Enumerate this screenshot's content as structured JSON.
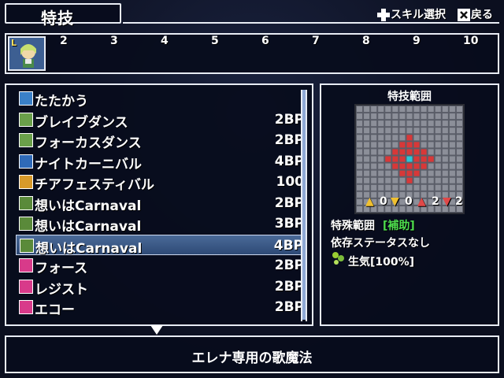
{
  "header": {
    "title": "特技",
    "skill_select": "スキル選択",
    "back": "戻る"
  },
  "party": {
    "portrait_badge": "L",
    "slots": [
      "2",
      "3",
      "4",
      "5",
      "6",
      "7",
      "8",
      "9",
      "10"
    ]
  },
  "skills": [
    {
      "name": "たたかう",
      "cost": "",
      "icon": "sword-icon",
      "icon_color": "#3a80c8"
    },
    {
      "name": "ブレイブダンス",
      "cost": "2BP",
      "icon": "plus-icon",
      "icon_color": "#6aa04a"
    },
    {
      "name": "フォーカスダンス",
      "cost": "2BP",
      "icon": "plus-icon",
      "icon_color": "#6aa04a"
    },
    {
      "name": "ナイトカーニバル",
      "cost": "4BP",
      "icon": "square-icon",
      "icon_color": "#2f6ab8"
    },
    {
      "name": "チアフェスティバル",
      "cost": "100",
      "icon": "star-burst-icon",
      "icon_color": "#d89a2a"
    },
    {
      "name": "想いはCarnaval",
      "cost": "2BP",
      "icon": "note-icon",
      "icon_color": "#5a8a3a"
    },
    {
      "name": "想いはCarnaval",
      "cost": "3BP",
      "icon": "note-up-icon",
      "icon_color": "#5a8a3a"
    },
    {
      "name": "想いはCarnaval",
      "cost": "4BP",
      "icon": "note-up2-icon",
      "icon_color": "#5a8a3a"
    },
    {
      "name": "フォース",
      "cost": "2BP",
      "icon": "voice-icon",
      "icon_color": "#d83a8a"
    },
    {
      "name": "レジスト",
      "cost": "2BP",
      "icon": "voice-icon",
      "icon_color": "#d83a8a"
    },
    {
      "name": "エコー",
      "cost": "2BP",
      "icon": "voice-icon",
      "icon_color": "#d83a8a"
    }
  ],
  "selected_index": 7,
  "info": {
    "title": "特技範囲",
    "stats": [
      "0",
      "0",
      "2",
      "2"
    ],
    "range_label": "特殊範囲",
    "range_type": "[補助]",
    "dependency": "依存ステータスなし",
    "attribute": "生気[100%]"
  },
  "description": "エレナ専用の歌魔法",
  "colors": {
    "accent_green": "#4ddc4d",
    "highlight_red": "#d83838",
    "center_cyan": "#28c8d8"
  }
}
